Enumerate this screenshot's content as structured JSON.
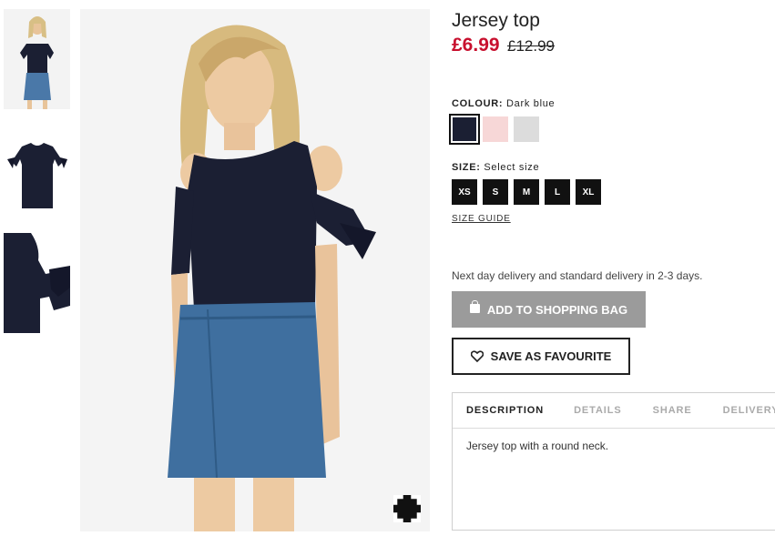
{
  "product": {
    "title": "Jersey top",
    "price_now": "£6.99",
    "price_was": "£12.99"
  },
  "colour": {
    "label": "COLOUR:",
    "selected": "Dark blue",
    "swatches": [
      {
        "name": "Dark blue",
        "hex": "#1b1f33"
      },
      {
        "name": "Light pink",
        "hex": "#f7d7d7"
      },
      {
        "name": "Light grey marl",
        "hex": "#dcdcdc"
      }
    ]
  },
  "size": {
    "label": "SIZE:",
    "prompt": "Select size",
    "options": [
      "XS",
      "S",
      "M",
      "L",
      "XL"
    ],
    "guide": "SIZE GUIDE"
  },
  "delivery_text": "Next day delivery and standard delivery in 2-3 days.",
  "buttons": {
    "add_to_bag": "ADD TO SHOPPING BAG",
    "save_favourite": "SAVE AS FAVOURITE"
  },
  "tabs": [
    "DESCRIPTION",
    "DETAILS",
    "SHARE",
    "DELIVERY"
  ],
  "description": "Jersey top with a round neck.",
  "colors": {
    "sale_red": "#c8102e",
    "add_button_bg": "#9b9b9b",
    "dark": "#111111"
  }
}
